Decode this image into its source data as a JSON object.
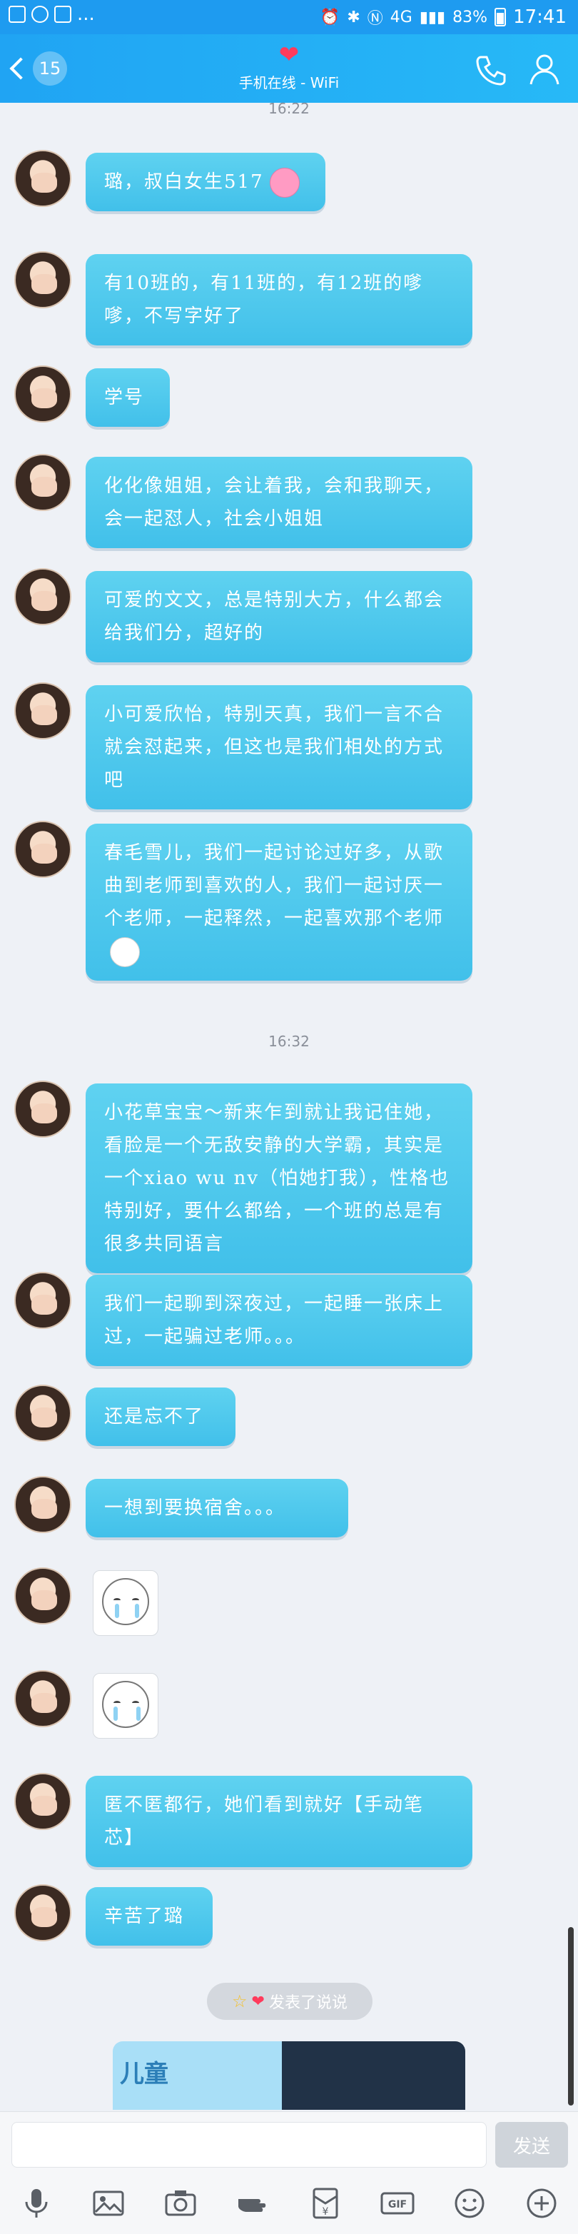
{
  "statusbar": {
    "battery": "83%",
    "time": "17:41",
    "network": "4G"
  },
  "header": {
    "badge": "15",
    "heart": "❤",
    "status": "手机在线 - WiFi"
  },
  "time_top": "16:22",
  "time_mid": "16:32",
  "messages": [
    {
      "text": "璐，叔白女生517"
    },
    {
      "text": "有10班的，有11班的，有12班的嗲嗲，不写字好了"
    },
    {
      "text": "学号"
    },
    {
      "text": "化化像姐姐，会让着我，会和我聊天，会一起怼人，社会小姐姐"
    },
    {
      "text": "可爱的文文，总是特别大方，什么都会给我们分，超好的"
    },
    {
      "text": "小可爱欣怡，特别天真，我们一言不合就会怼起来，但这也是我们相处的方式吧"
    },
    {
      "text": "春毛雪儿，我们一起讨论过好多，从歌曲到老师到喜欢的人，我们一起讨厌一个老师，一起释然，一起喜欢那个老师"
    },
    {
      "text": "小花草宝宝～新来乍到就让我记住她，看脸是一个无敌安静的大学霸，其实是一个xiao wu nv（怕她打我），性格也特别好，要什么都给，一个班的总是有很多共同语言"
    },
    {
      "text": "我们一起聊到深夜过，一起睡一张床上过，一起骗过老师。。。"
    },
    {
      "text": "还是忘不了"
    },
    {
      "text": "一想到要换宿舍。。。"
    },
    {
      "text": "匿不匿都行，她们看到就好【手动笔芯】"
    },
    {
      "text": "辛苦了璐"
    }
  ],
  "notice": {
    "text": "发表了说说"
  },
  "share": {
    "label": "儿童"
  },
  "input": {
    "placeholder": "",
    "send": "发送"
  },
  "toolbar": {
    "gif": "GIF"
  }
}
